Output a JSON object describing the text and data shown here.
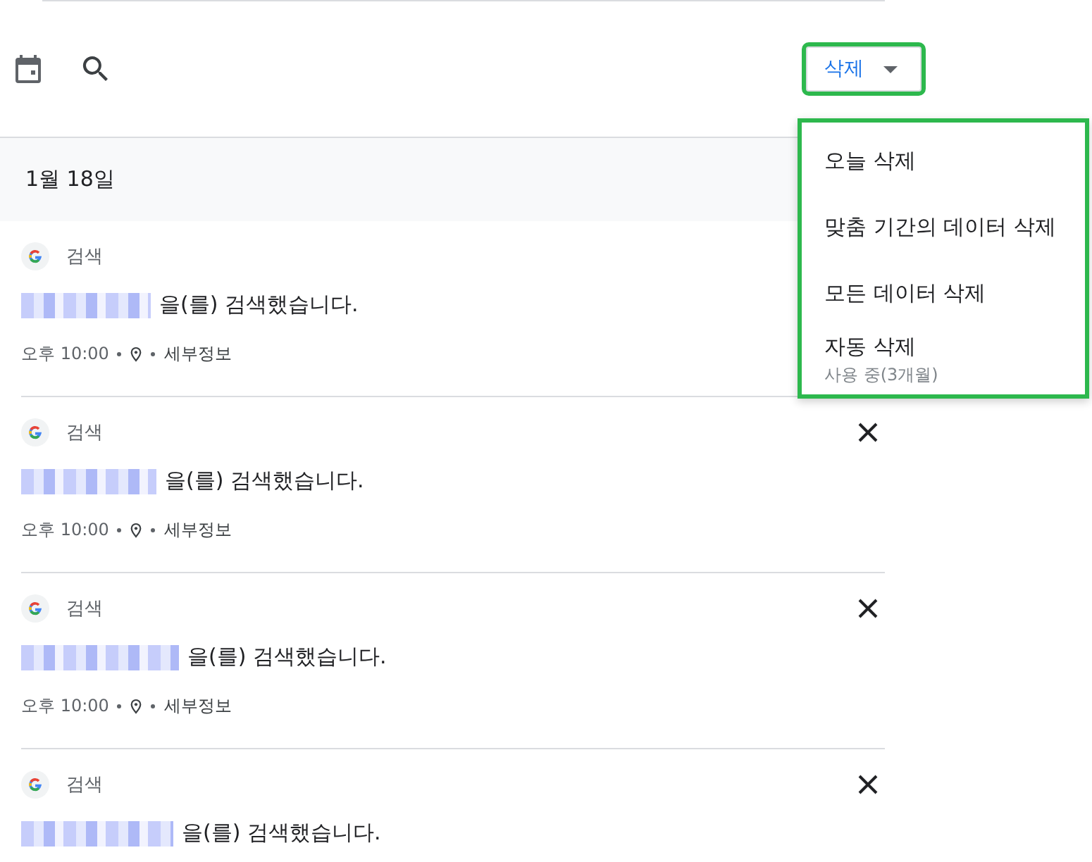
{
  "toolbar": {
    "delete_button": {
      "label": "삭제",
      "highlighted": true
    }
  },
  "date_header": "1월 18일",
  "items": [
    {
      "source": "검색",
      "query_suffix": "을(를) 검색했습니다.",
      "time": "오후 10:00",
      "details": "세부정보"
    },
    {
      "source": "검색",
      "query_suffix": "을(를) 검색했습니다.",
      "time": "오후 10:00",
      "details": "세부정보",
      "close_button": true
    },
    {
      "source": "검색",
      "query_suffix": "을(를) 검색했습니다.",
      "time": "오후 10:00",
      "details": "세부정보",
      "close_button": true
    },
    {
      "source": "검색",
      "query_suffix": "을(를) 검색했습니다.",
      "close_button": true
    }
  ],
  "delete_menu": {
    "highlighted": true,
    "items": [
      {
        "label": "오늘 삭제"
      },
      {
        "label": "맞춤 기간의 데이터 삭제"
      },
      {
        "label": "모든 데이터 삭제"
      },
      {
        "label": "자동 삭제",
        "sublabel": "사용 중(3개월)"
      }
    ]
  }
}
